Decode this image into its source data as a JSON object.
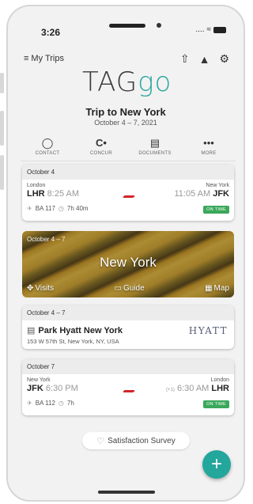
{
  "status_bar": {
    "time": "3:26",
    "signal": "....",
    "wifi": "wifi-icon",
    "battery": "battery-icon"
  },
  "header": {
    "menu_label": "My Trips",
    "logo_tag": "TAG",
    "logo_go": "go",
    "icons": [
      "share-icon",
      "bell-icon",
      "gear-icon"
    ]
  },
  "trip": {
    "title": "Trip to New York",
    "dates": "October 4 – 7, 2021"
  },
  "tabs": [
    {
      "label": "CONTACT",
      "icon": "chat-bubble-icon"
    },
    {
      "label": "CONCUR",
      "icon": "concur-logo-icon"
    },
    {
      "label": "DOCUMENTS",
      "icon": "briefcase-icon"
    },
    {
      "label": "MORE",
      "icon": "more-dots-icon"
    }
  ],
  "flight_out": {
    "header": "October 4",
    "from_city": "London",
    "from_code": "LHR",
    "depart_time": "8:25 AM",
    "to_city": "New York",
    "to_code": "JFK",
    "arrive_time": "11:05 AM",
    "flight_no": "BA 117",
    "duration": "7h 40m",
    "status": "ON TIME"
  },
  "city": {
    "dates": "October 4 – 7",
    "name": "New York",
    "actions": [
      "Visits",
      "Guide",
      "Map"
    ]
  },
  "hotel": {
    "header": "October 4 – 7",
    "name": "Park Hyatt New York",
    "address": "153 W 57th St, New York, NY, USA",
    "brand": "HYATT"
  },
  "flight_back": {
    "header": "October 7",
    "from_city": "New York",
    "from_code": "JFK",
    "depart_time": "6:30 PM",
    "to_city": "London",
    "to_code": "LHR",
    "day_offset": "(+1)",
    "arrive_time": "6:30 AM",
    "flight_no": "BA 112",
    "duration": "7h",
    "status": "ON TIME"
  },
  "survey_label": "Satisfaction Survey",
  "fab_label": "+",
  "colors": {
    "accent": "#23a69c",
    "on_time": "#3aa85a",
    "airline": "#d2232a"
  }
}
